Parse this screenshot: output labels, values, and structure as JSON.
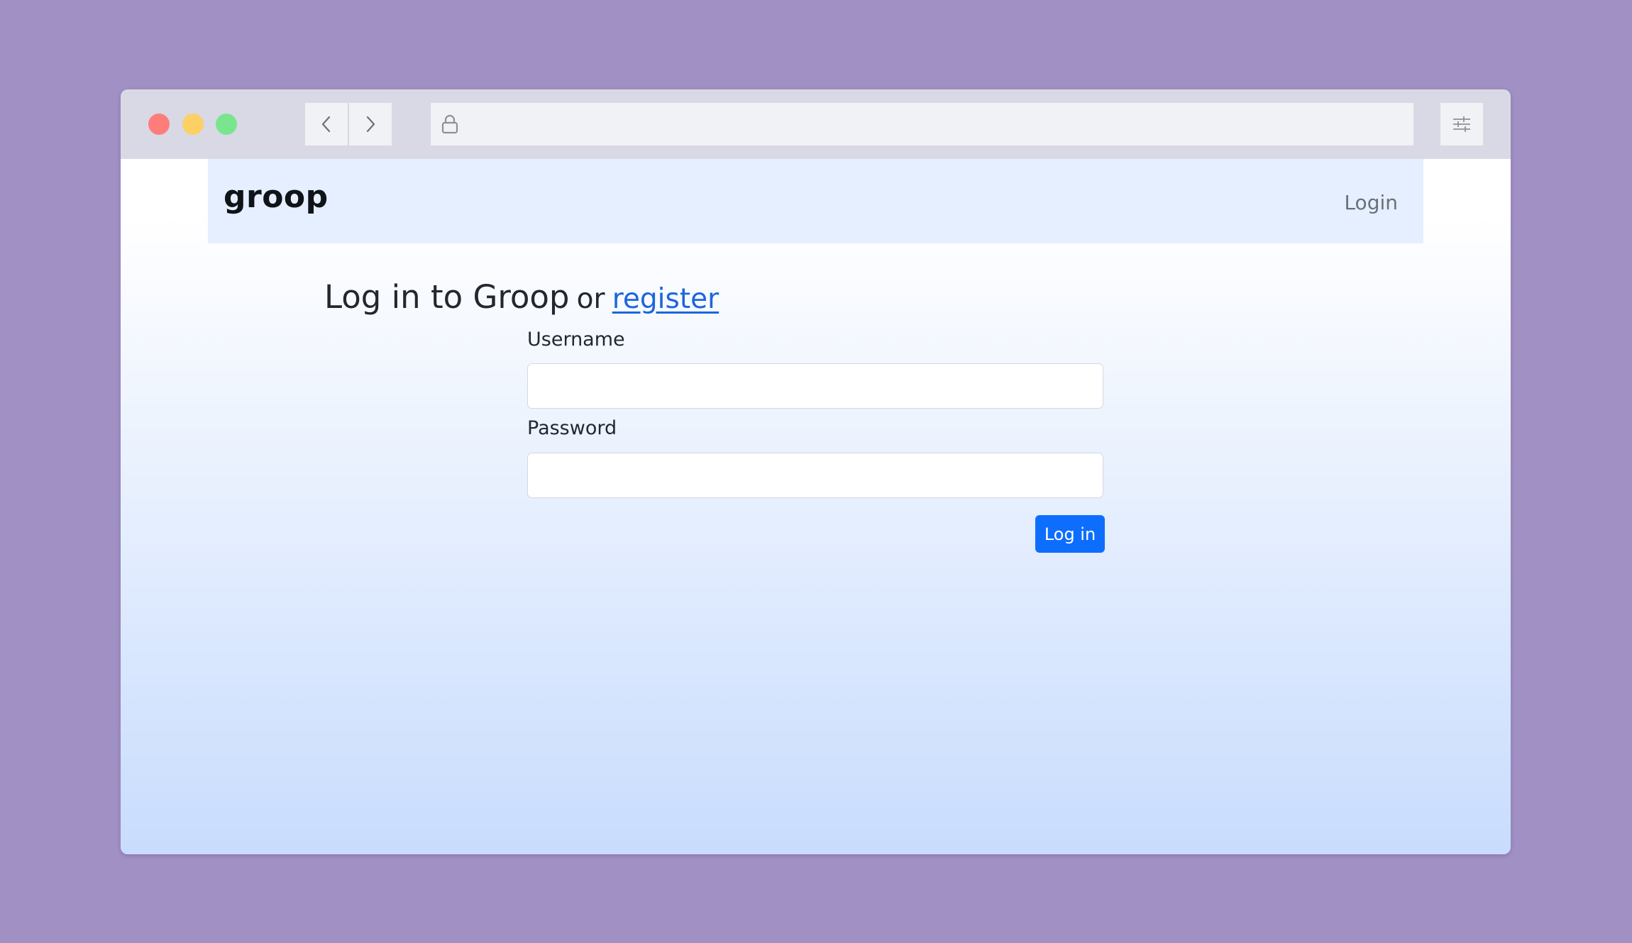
{
  "browser": {
    "url": "",
    "back_icon": "chevron-left-icon",
    "forward_icon": "chevron-right-icon",
    "lock_icon": "lock-icon",
    "settings_icon": "sliders-icon"
  },
  "navbar": {
    "brand": "groop",
    "login_link": "Login"
  },
  "page": {
    "heading_main": "Log in to Groop",
    "heading_or": "or",
    "heading_register_link": "register"
  },
  "form": {
    "username_label": "Username",
    "username_value": "",
    "password_label": "Password",
    "password_value": "",
    "submit_label": "Log in"
  },
  "colors": {
    "background": "#a190c4",
    "browser_chrome": "#d8d9e5",
    "navbar_bg": "#e5efff",
    "primary": "#0d6efd",
    "link": "#1d66da",
    "traffic_red": "#fe7d7a",
    "traffic_yellow": "#fcd064",
    "traffic_green": "#7ae58f"
  }
}
